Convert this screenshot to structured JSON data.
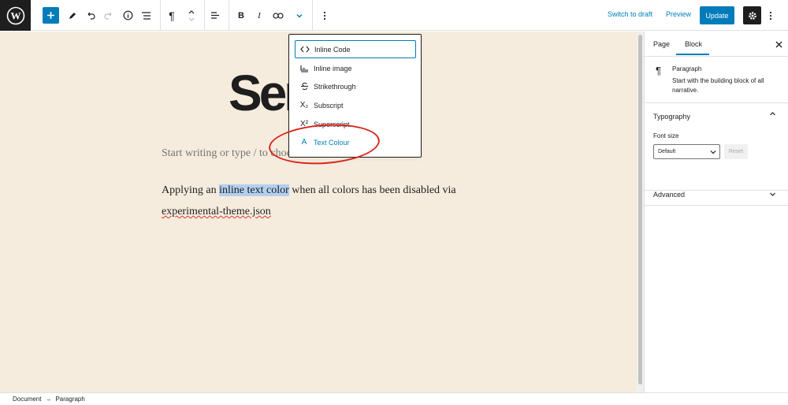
{
  "toolbar": {
    "switch_to_draft": "Switch to draft",
    "preview": "Preview",
    "update": "Update",
    "paragraph_glyph": "¶",
    "bold_glyph": "B",
    "italic_glyph": "I"
  },
  "editor": {
    "title_visible": "Ser",
    "placeholder": "Start writing or type / to choose a block",
    "paragraph": {
      "before": "Applying an ",
      "highlight": "inline text color",
      "after": " when all colors has been disabled via ",
      "link": "experimental-theme.json"
    }
  },
  "format_menu": {
    "items": [
      {
        "label": "Inline Code",
        "icon": "code-icon",
        "glyph": "< >"
      },
      {
        "label": "Inline image",
        "icon": "image-icon",
        "glyph": "▭"
      },
      {
        "label": "Strikethrough",
        "icon": "strikethrough-icon",
        "glyph": "S"
      },
      {
        "label": "Subscript",
        "icon": "subscript-icon",
        "glyph": "X₂"
      },
      {
        "label": "Superscript",
        "icon": "superscript-icon",
        "glyph": "X²"
      },
      {
        "label": "Text Colour",
        "icon": "text-color-icon",
        "glyph": "A"
      }
    ]
  },
  "sidebar": {
    "tabs": [
      "Page",
      "Block"
    ],
    "active_tab": "Block",
    "block": {
      "name": "Paragraph",
      "description": "Start with the building block of all narrative."
    },
    "typography": {
      "title": "Typography",
      "font_size_label": "Font size",
      "font_size_value": "Default",
      "reset": "Reset"
    },
    "advanced": {
      "title": "Advanced"
    }
  },
  "breadcrumb": [
    "Document",
    "Paragraph"
  ],
  "colors": {
    "accent": "#007cba",
    "canvas_bg": "#f5ecdd",
    "annotation": "#d9261c"
  }
}
